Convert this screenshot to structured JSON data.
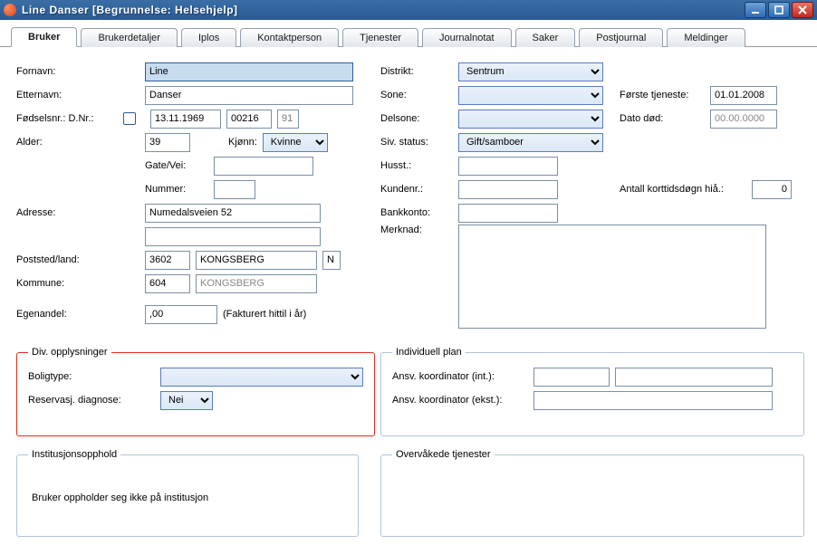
{
  "window": {
    "title": "Line Danser  [Begrunnelse: Helsehjelp]"
  },
  "tabs": {
    "t0": "Bruker",
    "t1": "Brukerdetaljer",
    "t2": "Iplos",
    "t3": "Kontaktperson",
    "t4": "Tjenester",
    "t5": "Journalnotat",
    "t6": "Saker",
    "t7": "Postjournal",
    "t8": "Meldinger"
  },
  "left": {
    "fornavn_label": "Fornavn:",
    "fornavn": "Line",
    "etternavn_label": "Etternavn:",
    "etternavn": "Danser",
    "fodsel_label": "Fødselsnr.:  D.Nr.:",
    "fodsel_val": "13.11.1969",
    "fodsel_b": "00216",
    "fodsel_c": "91",
    "alder_label": "Alder:",
    "alder": "39",
    "kjonn_label": "Kjønn:",
    "kjonn": "Kvinne",
    "gatevei_label": "Gate/Vei:",
    "nummer_label": "Nummer:",
    "adresse_label": "Adresse:",
    "adresse": "Numedalsveien 52",
    "poststed_label": "Poststed/land:",
    "postnr": "3602",
    "poststed": "KONGSBERG",
    "land": "N",
    "kommune_label": "Kommune:",
    "kommune_nr": "604",
    "kommune_navn": "KONGSBERG",
    "egenandel_label": "Egenandel:",
    "egenandel": ",00",
    "egenandel_note": "(Fakturert hittil i år)"
  },
  "right": {
    "distrikt_label": "Distrikt:",
    "distrikt": "Sentrum",
    "sone_label": "Sone:",
    "delsone_label": "Delsone:",
    "sivstatus_label": "Siv. status:",
    "sivstatus": "Gift/samboer",
    "husst_label": "Husst.:",
    "kundenr_label": "Kundenr.:",
    "bankkonto_label": "Bankkonto:",
    "merknad_label": "Merknad:",
    "forstetj_label": "Første tjeneste:",
    "forstetj": "01.01.2008",
    "datodod_label": "Dato død:",
    "datodod": "00.00.0000",
    "antallkortt_label": "Antall korttidsdøgn hiå.:",
    "antallkortt": "0"
  },
  "div": {
    "legend": "Div. opplysninger",
    "boligtype_label": "Boligtype:",
    "reservasj_label": "Reservasj. diagnose:",
    "reservasj": "Nei"
  },
  "ind": {
    "legend": "Individuell plan",
    "int_label": "Ansv. koordinator (int.):",
    "ekst_label": "Ansv. koordinator (ekst.):"
  },
  "inst": {
    "legend": "Institusjonsopphold",
    "text": "Bruker oppholder seg ikke på institusjon"
  },
  "overv": {
    "legend": "Overvåkede tjenester"
  }
}
